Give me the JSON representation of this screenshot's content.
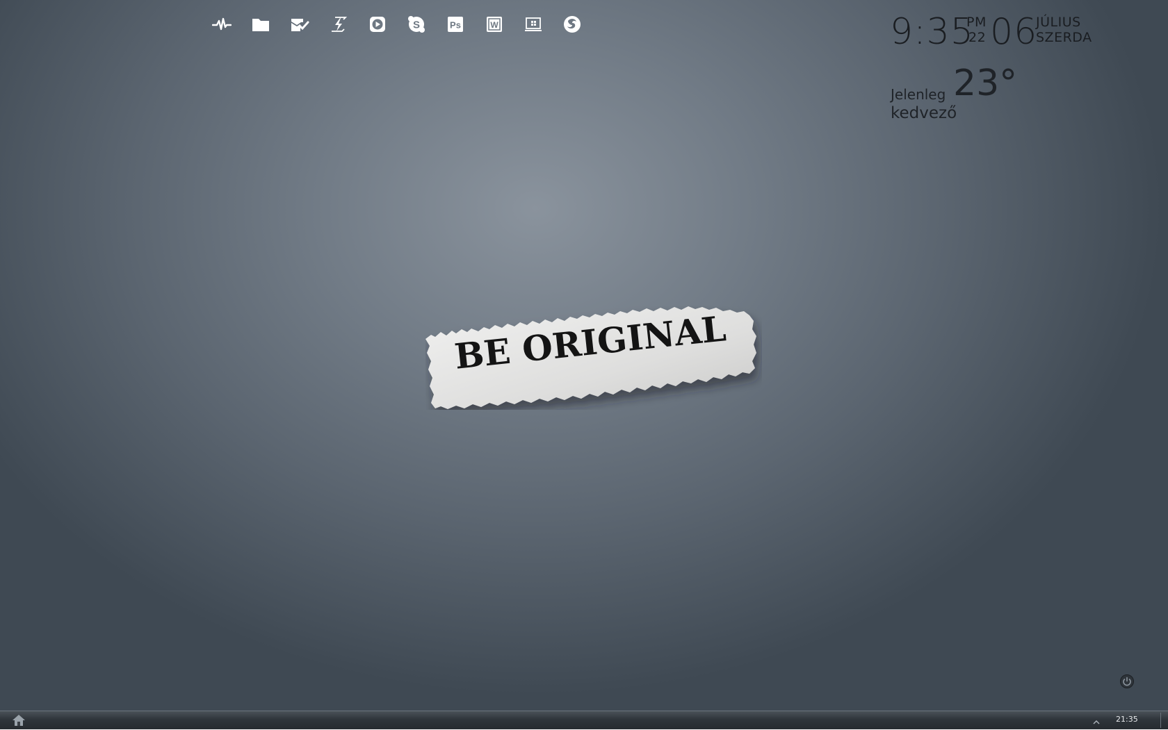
{
  "dock": {
    "items": [
      {
        "name": "pulse-icon"
      },
      {
        "name": "folder-icon"
      },
      {
        "name": "mail-icon"
      },
      {
        "name": "lightning-icon"
      },
      {
        "name": "media-player-icon"
      },
      {
        "name": "skype-icon"
      },
      {
        "name": "photoshop-icon",
        "label": "Ps"
      },
      {
        "name": "word-icon",
        "label": "W"
      },
      {
        "name": "windows-icon"
      },
      {
        "name": "firefox-icon"
      }
    ]
  },
  "clock": {
    "time": "9:35",
    "ampm": "PM",
    "year": "22",
    "day": "06",
    "month": "JÚLIUS",
    "weekday": "SZERDA"
  },
  "weather": {
    "label": "Jelenleg",
    "temperature": "23°",
    "condition": "kedvező"
  },
  "wallpaper": {
    "text": "BE ORIGINAL"
  },
  "taskbar": {
    "clock": "21:35"
  },
  "colors": {
    "icon": "#ffffff",
    "clock_text": "#1a1d21"
  }
}
